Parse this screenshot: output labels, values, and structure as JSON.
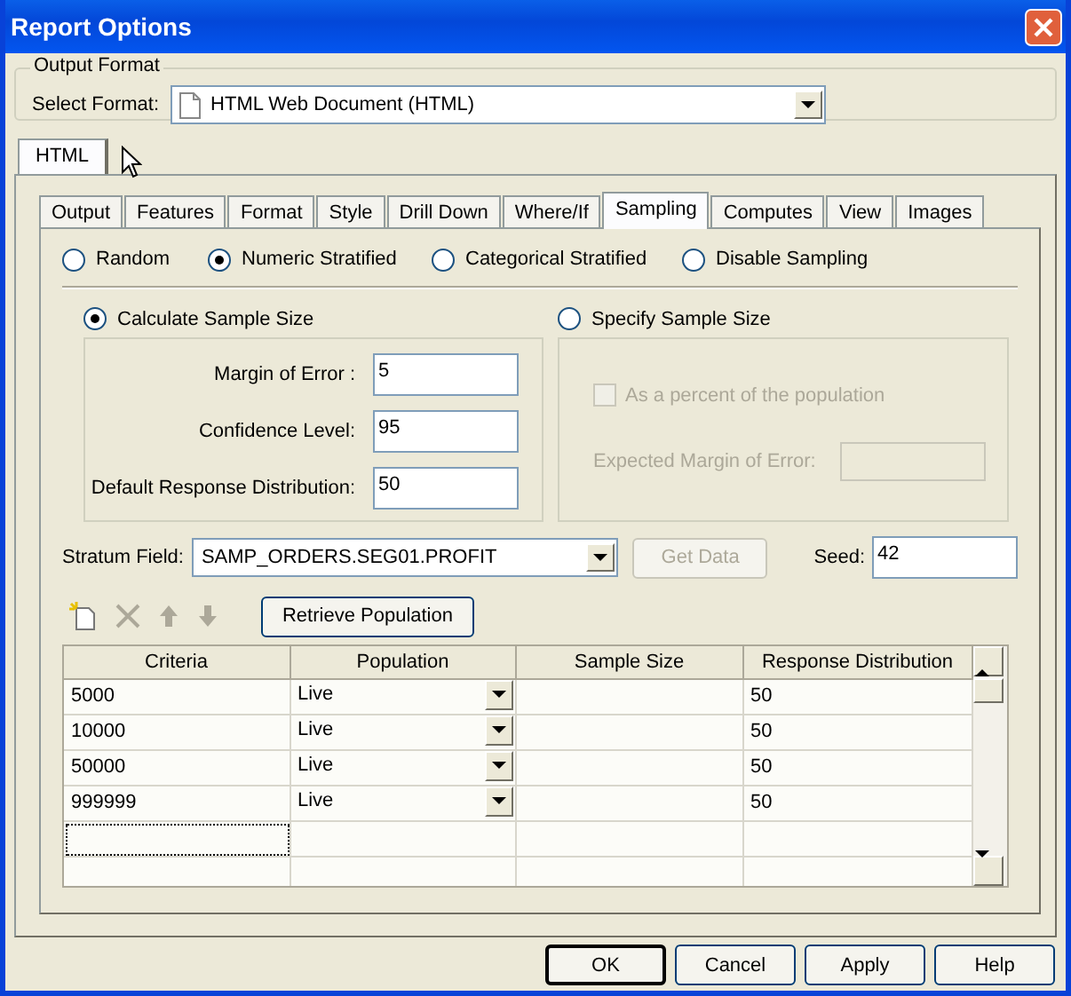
{
  "window": {
    "title": "Report Options"
  },
  "output_format": {
    "legend": "Output Format",
    "label": "Select Format:",
    "value": "HTML Web Document (HTML)"
  },
  "format_tabs": [
    {
      "label": "HTML",
      "selected": true
    }
  ],
  "tabs": [
    {
      "label": "Output",
      "selected": false
    },
    {
      "label": "Features",
      "selected": false
    },
    {
      "label": "Format",
      "selected": false
    },
    {
      "label": "Style",
      "selected": false
    },
    {
      "label": "Drill Down",
      "selected": false
    },
    {
      "label": "Where/If",
      "selected": false
    },
    {
      "label": "Sampling",
      "selected": true
    },
    {
      "label": "Computes",
      "selected": false
    },
    {
      "label": "View",
      "selected": false
    },
    {
      "label": "Images",
      "selected": false
    }
  ],
  "sampling_methods": [
    {
      "label": "Random",
      "selected": false
    },
    {
      "label": "Numeric Stratified",
      "selected": true
    },
    {
      "label": "Categorical Stratified",
      "selected": false
    },
    {
      "label": "Disable Sampling",
      "selected": false
    }
  ],
  "calculate": {
    "label": "Calculate Sample Size",
    "selected": true,
    "fields": [
      {
        "label": "Margin of Error :",
        "value": "5"
      },
      {
        "label": "Confidence Level:",
        "value": "95"
      },
      {
        "label": "Default Response Distribution:",
        "value": "50"
      }
    ]
  },
  "specify": {
    "label": "Specify Sample Size",
    "selected": false,
    "disabled": true,
    "percent": {
      "label": "As a percent of the population",
      "checked": false
    },
    "expected_label": "Expected Margin of Error:"
  },
  "stratum": {
    "label": "Stratum Field:",
    "value": "SAMP_ORDERS.SEG01.PROFIT"
  },
  "get_data": {
    "label": "Get Data",
    "disabled": true
  },
  "seed": {
    "label": "Seed:",
    "value": "42"
  },
  "tools": [
    {
      "kind": "new",
      "disabled": false
    },
    {
      "kind": "delete",
      "disabled": true
    },
    {
      "kind": "up",
      "disabled": true
    },
    {
      "kind": "down",
      "disabled": true
    }
  ],
  "retrieve_button": "Retrieve Population",
  "grid": {
    "columns": [
      "Criteria",
      "Population",
      "Sample Size",
      "Response Distribution"
    ],
    "rows": [
      {
        "criteria": "5000",
        "population": "Live",
        "response": "50"
      },
      {
        "criteria": "10000",
        "population": "Live",
        "response": "50"
      },
      {
        "criteria": "50000",
        "population": "Live",
        "response": "50"
      },
      {
        "criteria": "999999",
        "population": "Live",
        "response": "50"
      }
    ]
  },
  "buttons": [
    {
      "label": "OK",
      "default": true
    },
    {
      "label": "Cancel",
      "default": false
    },
    {
      "label": "Apply",
      "default": false
    },
    {
      "label": "Help",
      "default": false
    }
  ]
}
